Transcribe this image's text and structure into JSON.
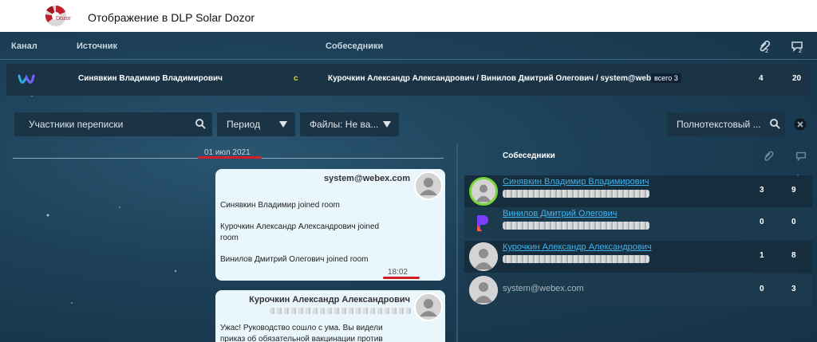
{
  "header": {
    "app_title": "Отображение в DLP Solar Dozor",
    "logo_text": "Dozor"
  },
  "table": {
    "columns": {
      "channel": "Канал",
      "source": "Источник",
      "peers": "Собеседники"
    },
    "head_icons": [
      {
        "icon": "attachment-count-icon",
        "count": "2"
      },
      {
        "icon": "message-count-icon",
        "count": "2"
      }
    ],
    "row": {
      "channel_icon": "webex-logo-icon",
      "source": "Синявкин Владимир Владимирович",
      "flag": "c",
      "peers": "Курочкин Александр Александрович / Винилов Дмитрий Олегович / system@webex.com",
      "total_badge": "всего 3",
      "attachments": "4",
      "messages": "20"
    }
  },
  "filters": {
    "participants_placeholder": "Участники переписки",
    "period": "Период",
    "files": "Файлы: Не ва...",
    "fulltext_placeholder": "Полнотекстовый ..."
  },
  "chat": {
    "date": "01 июл 2021",
    "messages": [
      {
        "author": "system@webex.com",
        "lines": [
          "Синявкин Владимир joined room",
          "Курочкин Александр Александрович joined",
          "room",
          "Винилов Дмитрий Олегович joined room"
        ],
        "time": "18:02"
      },
      {
        "author": "Курочкин Александр Александрович",
        "lines": [
          "Ужас! Руководство сошло с ума. Вы видели",
          "приказ об обязательной вакцинации против"
        ]
      }
    ]
  },
  "participants": {
    "title": "Собеседники",
    "rows": [
      {
        "name": "Синявкин Владимир Владимирович",
        "attachments": "3",
        "messages": "9"
      },
      {
        "name": "Винилов Дмитрий Олегович",
        "attachments": "0",
        "messages": "0"
      },
      {
        "name": "Курочкин Александр Александрович",
        "attachments": "1",
        "messages": "8"
      },
      {
        "name": "system@webex.com",
        "attachments": "0",
        "messages": "3"
      }
    ]
  },
  "colors": {
    "accent_red": "#d21f28",
    "link_blue": "#3fb4ec",
    "flag_yellow": "#e8d51d",
    "bubble": "#e9f7fc"
  }
}
